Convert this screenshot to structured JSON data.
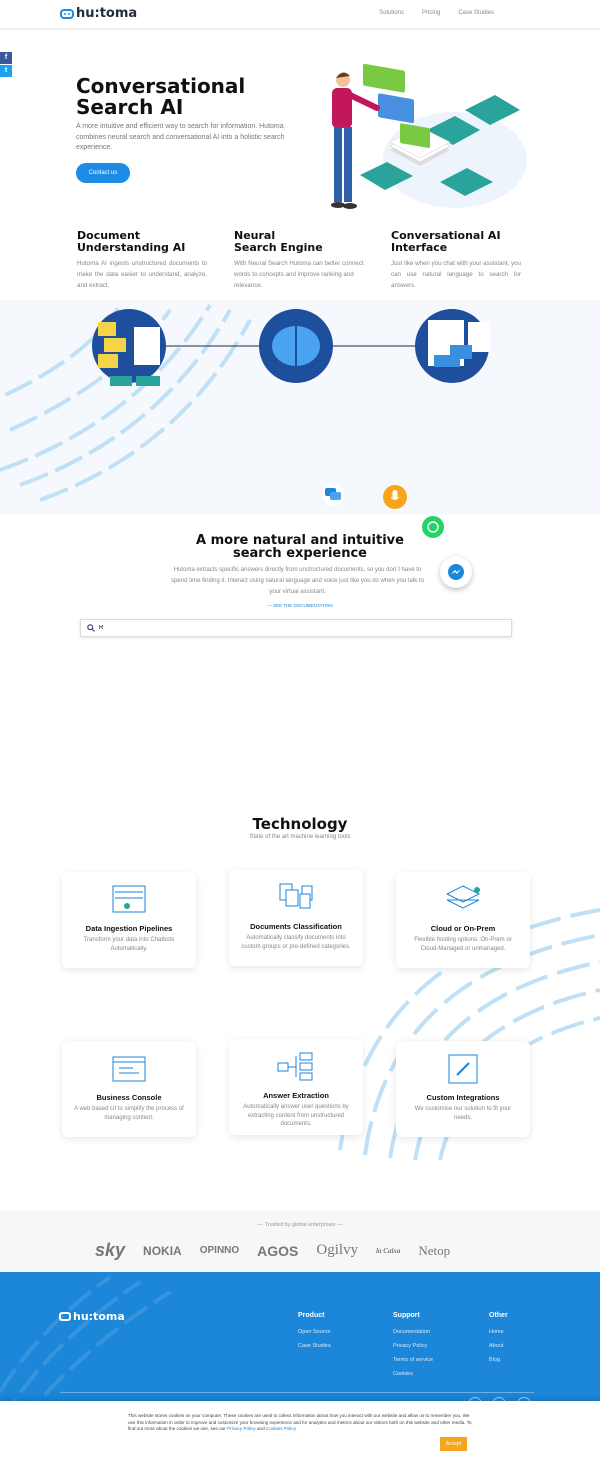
{
  "header": {
    "logo_text": "hu:toma",
    "nav": [
      "Solutions",
      "Pricing",
      "Case Studies"
    ]
  },
  "social": {
    "facebook": "f",
    "twitter": "t"
  },
  "hero": {
    "title_line1": "Conversational",
    "title_line2": "Search AI",
    "subtitle": "A more intuitive and efficient way to search for information. Hutoma combines neural search and  conversational AI into a holistic search experience.",
    "cta": "Contact us"
  },
  "features": [
    {
      "title_line1": "Document",
      "title_line2": "Understanding AI",
      "text": "Hutoma AI ingests unstructured documents to make the data easier to understand, analyze, and extract."
    },
    {
      "title_line1": "Neural",
      "title_line2": "Search Engine",
      "text": "With Neural Search Hutoma can better connect words to concepts and improve ranking and relevance."
    },
    {
      "title_line1": "Conversational AI",
      "title_line2": "Interface",
      "text": "Just like when you chat with your assistant, you can use natural language to search for answers."
    }
  ],
  "natural": {
    "title_line1": "A more natural and intuitive",
    "title_line2": "search experience",
    "text": "Hutoma extracts specific answers directly from unstructured documents, so you don´t have to spend time finding it.  Interact using natural language and voice just like you do when you talk to your virtual assistant.",
    "doc_link": "— SEE THE DOCUMENTATION"
  },
  "search": {
    "value": "R"
  },
  "technology": {
    "title": "Technology",
    "subtitle": "State of the art machine learning tools",
    "cards": [
      {
        "title": "Data Ingestion Pipelines",
        "text": "Transform your data into Chatbots Automatically."
      },
      {
        "title": "Documents Classification",
        "text": "Automatically classify documents into custom groups or pre-defined categories."
      },
      {
        "title": "Cloud or On-Prem",
        "text": "Flexible hosting options: On-Prem or Cloud-Managed or unmanaged."
      },
      {
        "title": "Business Console",
        "text": "A web based UI to simplify the process of managing content."
      },
      {
        "title": "Answer Extraction",
        "text": "Automatically answer user questions by extracting content from unstructured documents."
      },
      {
        "title": "Custom Integrations",
        "text": "We customise our solution to fit your needs."
      }
    ]
  },
  "trusted": {
    "label": "— Trusted by global enterprises —",
    "logos": [
      "sky",
      "NOKIA",
      "OPINNO",
      "AGOS",
      "Ogilvy",
      "la Caixa",
      "Netop"
    ]
  },
  "footer": {
    "logo_text": "hu:toma",
    "product": {
      "title": "Product",
      "links": [
        "Open Source",
        "Case Studies"
      ]
    },
    "support": {
      "title": "Support",
      "links": [
        "Documentation",
        "Privacy Policy",
        "Terms of service",
        "Cookies"
      ]
    },
    "other": {
      "title": "Other",
      "links": [
        "Home",
        "About",
        "Blog"
      ]
    }
  },
  "cookie": {
    "text": "This website stores cookies on your computer. These cookies are used to collect information about how you interact with our website and allow us to remember you. We use this information in order to improve and customize your browsing experience and for analytics and metrics about our visitors both on this website and other media. To find out more about the cookies we use, see our ",
    "privacy": "Privacy Policy",
    "and": " and ",
    "cookies_policy": "Cookies Policy",
    "accept": "Accept"
  },
  "colors": {
    "accent": "#1c86d8",
    "accept": "#f7a51c",
    "teal": "#2aa39a",
    "green": "#7ac943"
  }
}
